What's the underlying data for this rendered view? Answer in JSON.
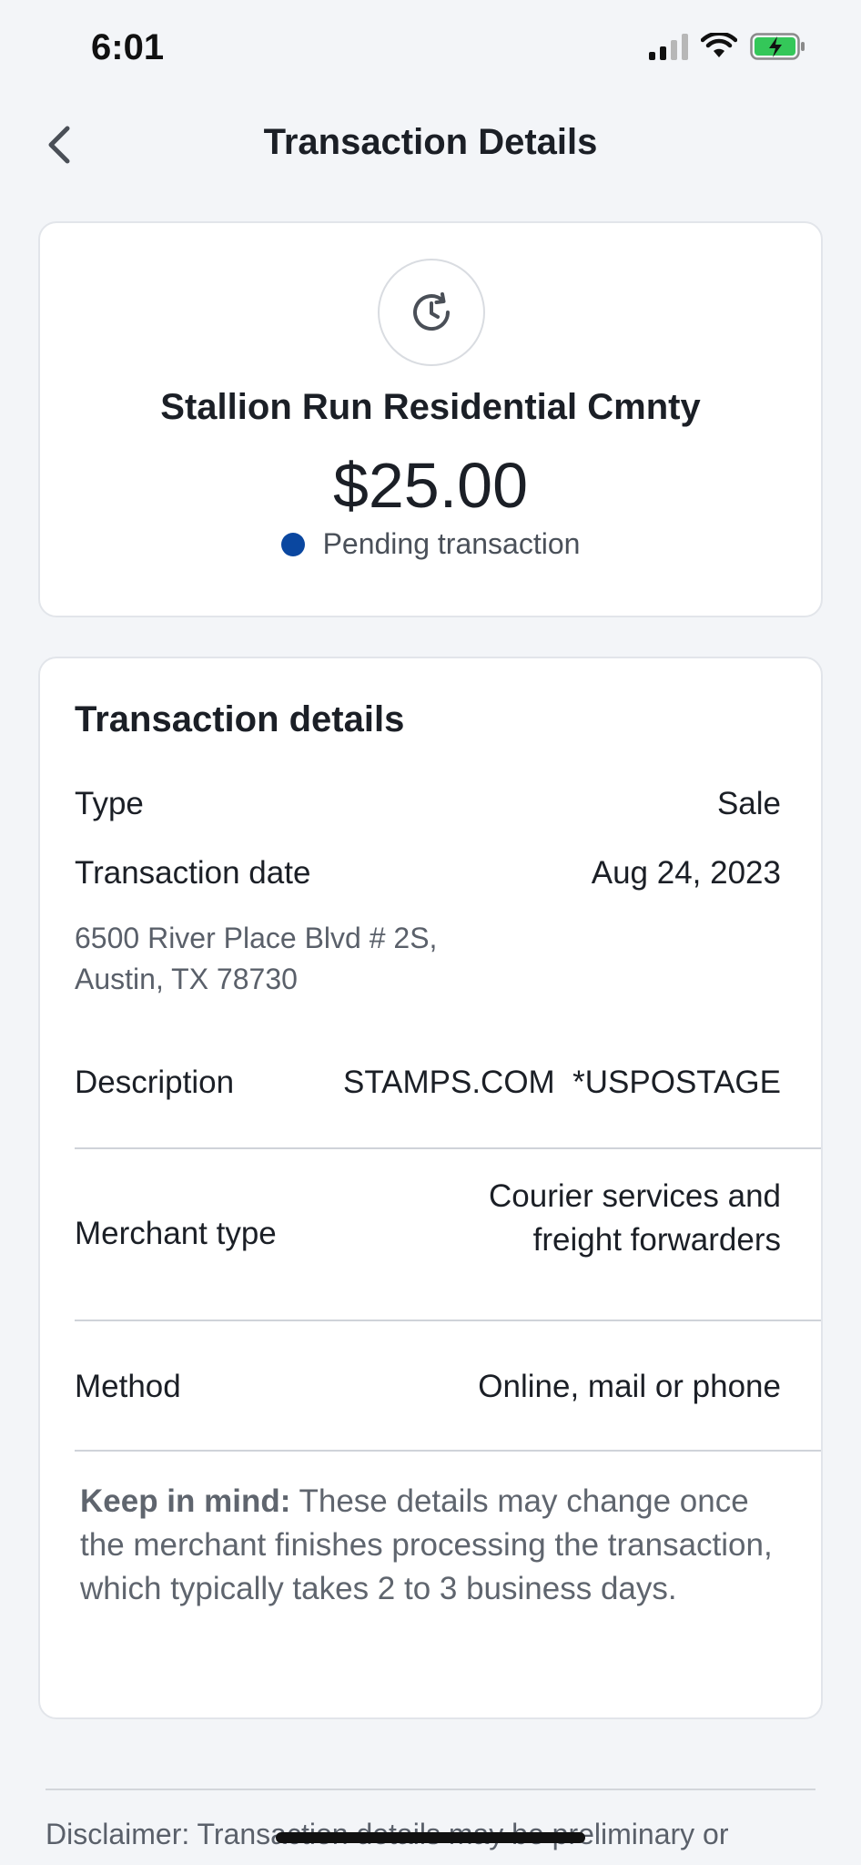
{
  "status_bar": {
    "time": "6:01"
  },
  "nav": {
    "title": "Transaction Details"
  },
  "summary": {
    "merchant": "Stallion Run Residential Cmnty",
    "amount": "$25.00",
    "status": "Pending transaction",
    "status_color": "#0a47a0"
  },
  "details": {
    "title": "Transaction details",
    "type_label": "Type",
    "type_value": "Sale",
    "date_label": "Transaction date",
    "date_value": "Aug 24, 2023",
    "address_line1": "6500 River Place Blvd # 2S,",
    "address_line2": "Austin, TX 78730",
    "description_label": "Description",
    "description_value": "STAMPS.COM  *USPOSTAGE",
    "merchant_type_label": "Merchant type",
    "merchant_type_value_line1": "Courier services and",
    "merchant_type_value_line2": "freight forwarders",
    "method_label": "Method",
    "method_value": "Online, mail or phone",
    "note_bold": "Keep in mind:",
    "note_text": " These details may change once the merchant finishes processing the transaction, which typically takes 2 to 3 business days."
  },
  "footer": {
    "disclaimer": "Disclaimer: Transaction details may be preliminary or"
  }
}
